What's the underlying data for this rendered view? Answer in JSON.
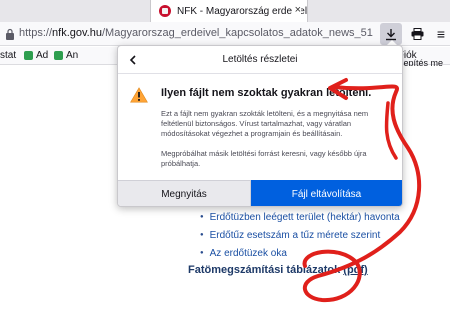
{
  "tab": {
    "title": "NFK - Magyarország erdeivel ka",
    "close": "×"
  },
  "navbar": {
    "url_prefix": "https://",
    "url_domain": "nfk.gov.hu",
    "url_path": "/Magyarorszag_erdeivel_kapcsolatos_adatok_news_51",
    "menu_icon": "≡"
  },
  "bookmarks": [
    {
      "label": "stat",
      "icon": "bookmark-icon"
    },
    {
      "label": "Ad",
      "icon": "green-square-icon",
      "color": "#2e9e4f"
    },
    {
      "label": "An",
      "icon": "green-square-icon",
      "color": "#2e9e4f"
    },
    {
      "label": "GFiók",
      "icon": "google-icon"
    },
    {
      "label": "telepítés me",
      "icon": "blue-dot-icon",
      "color": "#2a6fdb"
    }
  ],
  "panel": {
    "title": "Letöltés részletei",
    "heading": "Ilyen fájlt nem szoktak gyakran letölteni.",
    "paragraph1": "Ezt a fájlt nem gyakran szokták letölteni, és a megnyitása nem feltétlenül biztonságos. Vírust tartalmazhat, vagy váratlan módosításokat végezhet a programjain és beállításain.",
    "paragraph2": "Megpróbálhat másik letöltési forrást keresni, vagy később újra próbálhatja.",
    "open_label": "Megnyitás",
    "delete_label": "Fájl eltávolítása",
    "colors": {
      "primary": "#0060df",
      "warning": "#ffa436"
    }
  },
  "page": {
    "links": [
      "Erdőtüzben leégett terület (hektár) havonta",
      "Erdőtűz esetszám a tűz mérete szerint",
      "Az erdőtüzek oka"
    ],
    "section_title": "Fatömegszámítási táblázatok",
    "pdf_link": "(pdf)"
  },
  "annotation": {
    "color": "#e0201b"
  }
}
